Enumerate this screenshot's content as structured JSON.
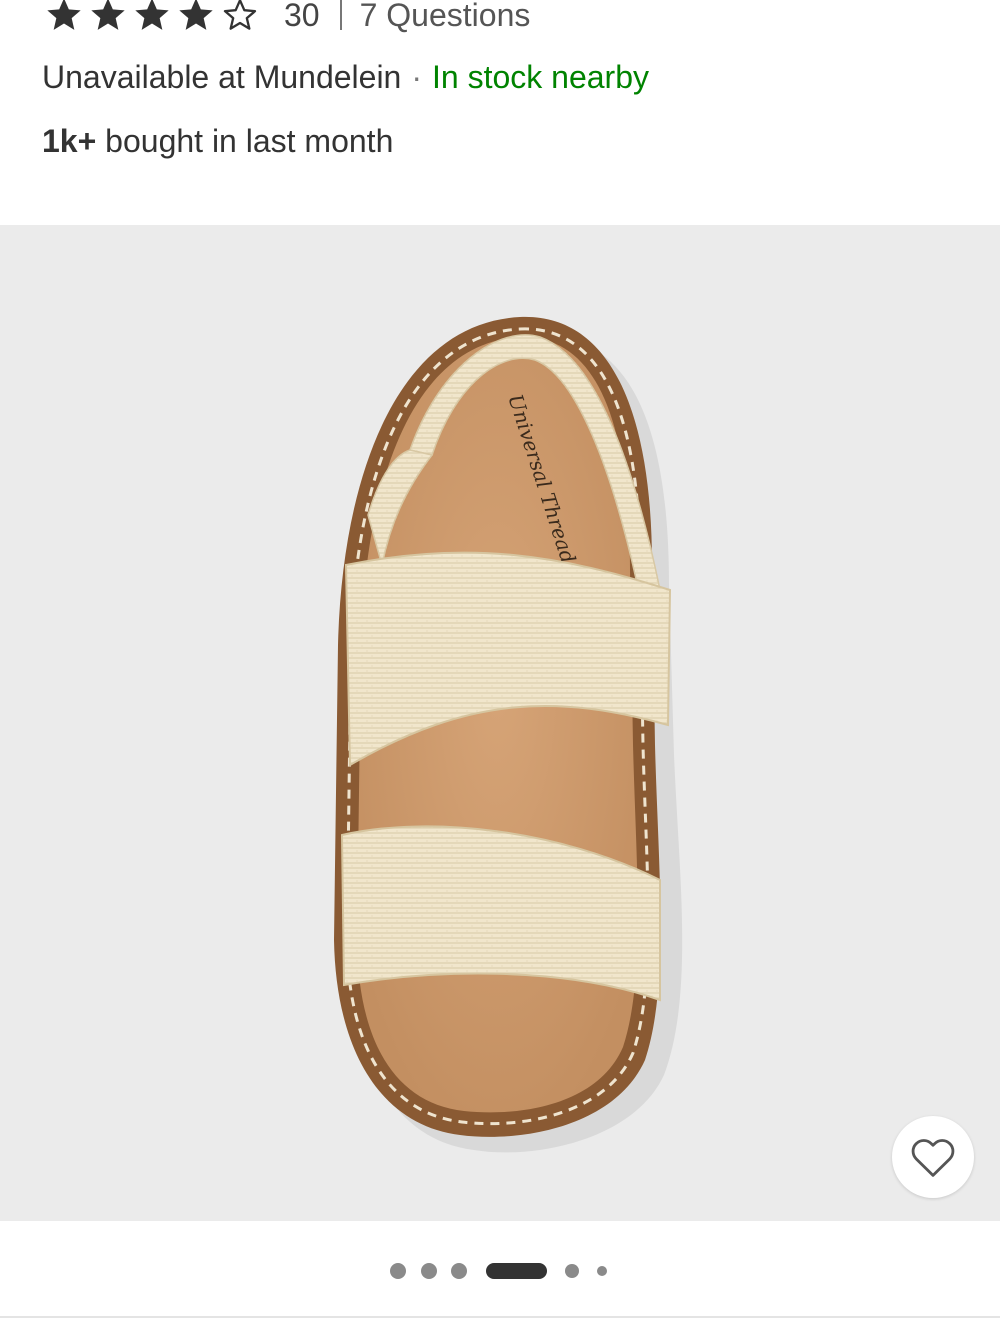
{
  "rating": {
    "stars_value": 4,
    "stars_max": 5,
    "star_icons": [
      "star-filled-icon",
      "star-filled-icon",
      "star-filled-icon",
      "star-filled-icon",
      "star-outline-icon"
    ],
    "count": "30",
    "questions_label": "7 Questions"
  },
  "availability": {
    "store_text": "Unavailable at Mundelein",
    "separator": "·",
    "nearby_text": "In stock nearby",
    "nearby_color": "#008300"
  },
  "social_proof": {
    "count": "1k+",
    "text": "bought in last month"
  },
  "gallery": {
    "image_subject": "sandal-product-image",
    "favorite_icon": "heart-outline-icon",
    "pagination": {
      "total": 6,
      "active_index": 3
    },
    "background_color": "#ebebeb"
  }
}
